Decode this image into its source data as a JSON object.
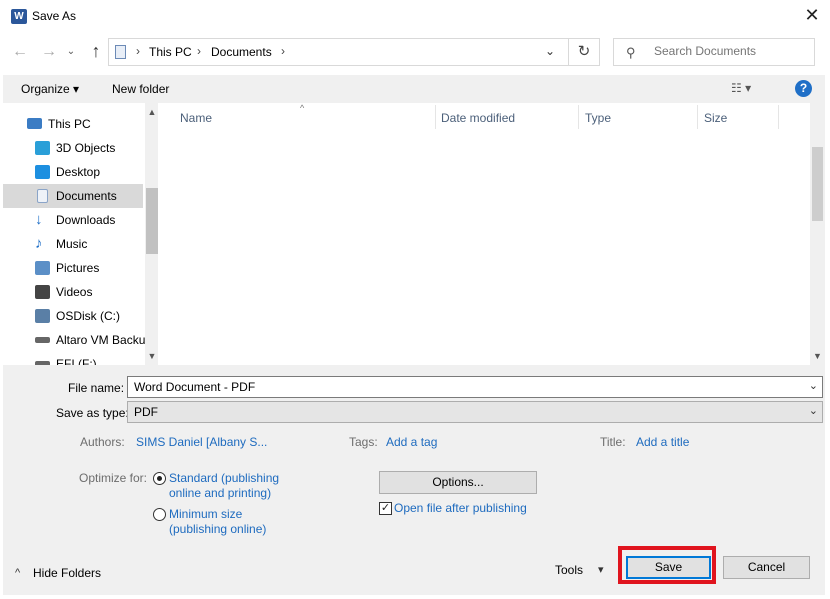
{
  "window": {
    "title": "Save As",
    "app_icon_letter": "W",
    "close_glyph": "✕"
  },
  "nav": {
    "back_glyph": "←",
    "forward_glyph": "→",
    "up_glyph": "↑",
    "recent_glyph": "⌄"
  },
  "address": {
    "crumbs": [
      "This PC",
      "Documents"
    ],
    "sep_glyph": "›",
    "dropdown_glyph": "⌄",
    "refresh_glyph": "↻"
  },
  "search": {
    "placeholder": "Search Documents"
  },
  "toolbar": {
    "organize_label": "Organize ▾",
    "new_folder_label": "New folder",
    "view_label": "☷ ▾",
    "help_glyph": "?"
  },
  "sidebar": {
    "items": [
      {
        "label": "This PC",
        "icon": "computer-icon",
        "color": "#3b7cc4"
      },
      {
        "label": "3D Objects",
        "icon": "cube-icon",
        "color": "#2a9fd8"
      },
      {
        "label": "Desktop",
        "icon": "desktop-icon",
        "color": "#1d8fe0"
      },
      {
        "label": "Documents",
        "icon": "documents-icon",
        "color": "#8aa4c8"
      },
      {
        "label": "Downloads",
        "icon": "download-icon",
        "color": "#1f6fc7"
      },
      {
        "label": "Music",
        "icon": "music-icon",
        "color": "#1f6fc7"
      },
      {
        "label": "Pictures",
        "icon": "pictures-icon",
        "color": "#5b8fc7"
      },
      {
        "label": "Videos",
        "icon": "videos-icon",
        "color": "#444444"
      },
      {
        "label": "OSDisk (C:)",
        "icon": "disk-icon",
        "color": "#5a7fa6"
      },
      {
        "label": "Altaro VM Backu",
        "icon": "drive-icon",
        "color": "#666666"
      },
      {
        "label": "EFI (F:)",
        "icon": "drive-icon",
        "color": "#666666"
      }
    ],
    "selected_index": 3
  },
  "file_list": {
    "columns": [
      "Name",
      "Date modified",
      "Type",
      "Size"
    ],
    "sort_glyph": "^"
  },
  "form": {
    "file_name_label": "File name:",
    "file_name_value": "Word Document - PDF",
    "save_as_type_label": "Save as type:",
    "save_as_type_value": "PDF",
    "authors_label": "Authors:",
    "authors_value": "SIMS Daniel [Albany S...",
    "tags_label": "Tags:",
    "tags_value": "Add a tag",
    "title_label": "Title:",
    "title_value": "Add a title",
    "optimize_label": "Optimize for:",
    "optimize_standard_1": "Standard (publishing",
    "optimize_standard_2": "online and printing)",
    "optimize_minimum_1": "Minimum size",
    "optimize_minimum_2": "(publishing online)",
    "options_label": "Options...",
    "open_after_label": "Open file after publishing",
    "checkbox_glyph": "✓"
  },
  "footer": {
    "hide_folders_label": "Hide Folders",
    "hide_caret": "^",
    "tools_label": "Tools",
    "tools_caret": "▾",
    "save_label": "Save",
    "cancel_label": "Cancel"
  },
  "colors": {
    "accent": "#0078d7",
    "link": "#1e6bbf",
    "highlight": "#e0141e"
  }
}
